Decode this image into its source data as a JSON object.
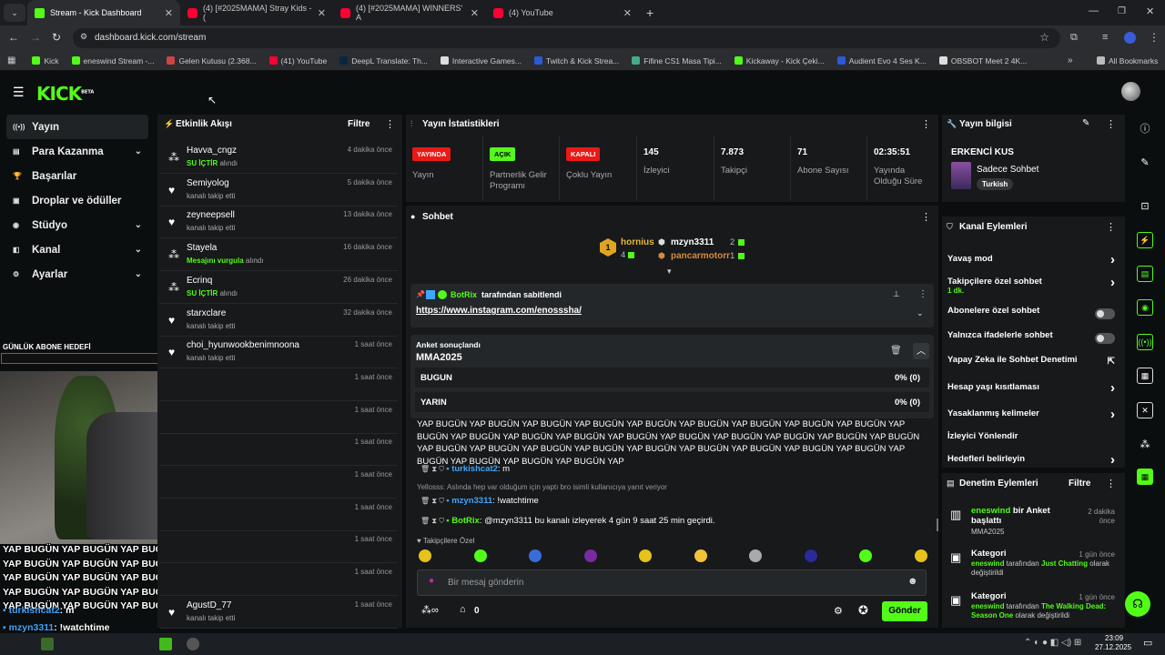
{
  "browser": {
    "tabs": [
      {
        "title": "Stream - Kick Dashboard",
        "favicon": "kick"
      },
      {
        "title": "(4) [#2025MAMA] Stray Kids - (",
        "favicon": "youtube"
      },
      {
        "title": "(4) [#2025MAMA] WINNERS' A",
        "favicon": "youtube"
      },
      {
        "title": "(4) YouTube",
        "favicon": "youtube"
      }
    ],
    "url": "dashboard.kick.com/stream",
    "bookmarks": [
      "Kick",
      "eneswind Stream -...",
      "Gelen Kutusu (2.368...",
      "(41) YouTube",
      "DeepL Translate: Th...",
      "Interactive Games...",
      "Twitch & Kick Strea...",
      "Fifine CS1 Masa Tipi...",
      "Kickaway - Kick Çeki...",
      "Audient Evo 4 Ses K...",
      "OBSBOT Meet 2 4K..."
    ],
    "all_bookmarks": "All Bookmarks"
  },
  "kick": {
    "logo": "KICK",
    "beta": "BETA"
  },
  "nav": {
    "items": [
      {
        "label": "Yayın",
        "icon": "broadcast-icon",
        "active": true,
        "chevron": false
      },
      {
        "label": "Para Kazanma",
        "icon": "money-icon",
        "chevron": true
      },
      {
        "label": "Başarılar",
        "icon": "trophy-icon",
        "chevron": false
      },
      {
        "label": "Droplar ve ödüller",
        "icon": "gift-icon",
        "chevron": false
      },
      {
        "label": "Stüdyo",
        "icon": "studio-icon",
        "chevron": true
      },
      {
        "label": "Kanal",
        "icon": "channel-icon",
        "chevron": true
      },
      {
        "label": "Ayarlar",
        "icon": "gear-icon",
        "chevron": true
      }
    ]
  },
  "activity": {
    "title": "Etkinlik Akışı",
    "filter": "Filtre",
    "events": [
      {
        "name": "Havva_cngz",
        "highlight": "SU İÇTİR",
        "desc": " alındı",
        "time": "4 dakika önce",
        "icon": "reward"
      },
      {
        "name": "Semiyolog",
        "highlight": "",
        "desc": "kanalı takip etti",
        "time": "5 dakika önce",
        "icon": "heart"
      },
      {
        "name": "zeyneepsell",
        "highlight": "",
        "desc": "kanalı takip etti",
        "time": "13 dakika önce",
        "icon": "heart"
      },
      {
        "name": "Stayela",
        "highlight": "Mesajını vurgula",
        "desc": " alındı",
        "time": "16 dakika önce",
        "icon": "reward"
      },
      {
        "name": "Ecrinq",
        "highlight": "SU İÇTİR",
        "desc": " alındı",
        "time": "26 dakika önce",
        "icon": "reward"
      },
      {
        "name": "starxclare",
        "highlight": "",
        "desc": "kanalı takip etti",
        "time": "32 dakika önce",
        "icon": "heart"
      },
      {
        "name": "choi_hyunwookbenimnoona",
        "highlight": "",
        "desc": "kanalı takip etti",
        "time": "1 saat önce",
        "icon": "heart"
      },
      {
        "name": "",
        "highlight": "",
        "desc": "",
        "time": "1 saat önce",
        "icon": ""
      },
      {
        "name": "",
        "highlight": "",
        "desc": "",
        "time": "1 saat önce",
        "icon": ""
      },
      {
        "name": "",
        "highlight": "",
        "desc": "",
        "time": "1 saat önce",
        "icon": ""
      },
      {
        "name": "",
        "highlight": "",
        "desc": "",
        "time": "1 saat önce",
        "icon": ""
      },
      {
        "name": "",
        "highlight": "",
        "desc": "",
        "time": "1 saat önce",
        "icon": ""
      },
      {
        "name": "",
        "highlight": "",
        "desc": "",
        "time": "1 saat önce",
        "icon": ""
      },
      {
        "name": "",
        "highlight": "",
        "desc": "",
        "time": "1 saat önce",
        "icon": ""
      },
      {
        "name": "AgustD_77",
        "highlight": "",
        "desc": "kanalı takip etti",
        "time": "1 saat önce",
        "icon": "heart"
      }
    ]
  },
  "overlay": {
    "goal_label": "GÜNLÜK ABONE HEDEFİ",
    "spam_lines": [
      "YAP BUGÜN YAP BUGÜN YAP BUGÜN YAP BUGÜN YAP BUGÜN",
      "YAP BUGÜN YAP BUGÜN YAP BUGÜN YAP BUGÜN YAP BUGÜN",
      "YAP BUGÜN YAP BUGÜN YAP BUGÜN YAP BUGÜN YAP BUGÜN",
      "YAP BUGÜN YAP BUGÜN YAP BUGÜN YAP BUGÜN YAP BUGÜN",
      "YAP BUGÜN YAP BUGÜN YAP BUGÜN YAP BUGÜN YAP BUGÜN YAP"
    ],
    "chat": [
      {
        "user": "turkishcat2",
        "msg": ": m",
        "color": "#3ea6ff"
      },
      {
        "user": "mzyn3311",
        "msg": ": !watchtime",
        "color": "#3ea6ff"
      },
      {
        "user": "BotRix",
        "msg": ": @mzyn3311 bu kanalı izleyerek 4 gün 9 saat 25 min geçirdi.",
        "color": "#53fc18"
      }
    ]
  },
  "stats": {
    "title": "Yayın İstatistikleri",
    "items": [
      {
        "badge": "YAYINDA",
        "badge_bg": "#e91916",
        "badge_fg": "#fff",
        "label": "Yayın"
      },
      {
        "badge": "AÇIK",
        "badge_bg": "#53fc18",
        "badge_fg": "#000",
        "label": "Partnerlik Gelir Programı"
      },
      {
        "badge": "KAPALI",
        "badge_bg": "#e91916",
        "badge_fg": "#fff",
        "label": "Çoklu Yayın"
      },
      {
        "value": "145",
        "label": "İzleyici"
      },
      {
        "value": "7.873",
        "label": "Takipçi"
      },
      {
        "value": "71",
        "label": "Abone Sayısı"
      },
      {
        "value": "02:35:51",
        "label": "Yayında Olduğu Süre"
      }
    ]
  },
  "chat": {
    "title": "Sohbet",
    "leaderboard": [
      {
        "rank": "1",
        "name": "hornius",
        "count": "4"
      },
      {
        "name": "mzyn3311",
        "count": "2"
      },
      {
        "name": "pancarmotorr",
        "count": "1"
      }
    ],
    "pinned": {
      "by": "BotRix",
      "suffix": " tarafından sabitlendi",
      "link": "https://www.instagram.com/enosssha/"
    },
    "poll": {
      "status": "Anket sonuçlandı",
      "title": "MMA2025",
      "options": [
        {
          "label": "BUGUN",
          "result": "0% (0)",
          "fraction": 0
        },
        {
          "label": "YARIN",
          "result": "0% (0)",
          "fraction": 0
        }
      ]
    },
    "spam": "YAP BUGÜN YAP BUGÜN YAP BUGÜN YAP BUGÜN YAP BUGÜN YAP BUGÜN YAP BUGÜN YAP BUGÜN YAP BUGÜN YAP BUGÜN YAP BUGÜN YAP BUGÜN YAP BUGÜN YAP BUGÜN YAP BUGÜN YAP BUGÜN YAP BUGÜN YAP BUGÜN YAP BUGÜN YAP BUGÜN YAP BUGÜN YAP BUGÜN YAP BUGÜN YAP BUGÜN YAP BUGÜN YAP BUGÜN YAP BUGÜN YAP BUGÜN YAP BUGÜN YAP BUGÜN YAP BUGÜN YAP BUGÜN YAP",
    "messages": [
      {
        "user": "turkishcat2",
        "text": ": m",
        "color": "#3ea6ff"
      },
      {
        "reply": "Yellosss: Aslında hep var olduğum için yaptı bro isimli kullanıcıya yanıt veriyor",
        "user": "mzyn3311",
        "text": ": !watchtime",
        "color": "#3ea6ff"
      },
      {
        "user": "BotRix",
        "text": ": @mzyn3311 bu kanalı izleyerek 4 gün 9 saat 25 min geçirdi.",
        "color": "#53fc18"
      }
    ],
    "emote_label": "Takipçilere Özel",
    "placeholder": "Bir mesaj gönderin",
    "points": "0",
    "send": "Gönder"
  },
  "info": {
    "title": "Yayın bilgisi",
    "stream_title": "ERKENCİ KUS",
    "category": "Sadece Sohbet",
    "tag": "Turkish"
  },
  "actions": {
    "title": "Kanal Eylemleri",
    "rows": [
      {
        "label": "Yavaş mod",
        "type": "arrow"
      },
      {
        "label": "Takipçilere özel sohbet",
        "sub": "1 dk.",
        "type": "arrow"
      },
      {
        "label": "Abonelere özel sohbet",
        "type": "toggle"
      },
      {
        "label": "Yalnızca ifadelerle sohbet",
        "type": "toggle"
      },
      {
        "label": "Yapay Zeka ile Sohbet Denetimi",
        "type": "link"
      },
      {
        "label": "Hesap yaşı kısıtlaması",
        "type": "arrow"
      },
      {
        "label": "Yasaklanmış kelimeler",
        "type": "arrow"
      },
      {
        "label": "İzleyici Yönlendir",
        "type": "none"
      },
      {
        "label": "Hedefleri belirleyin",
        "type": "arrow"
      }
    ]
  },
  "moderation": {
    "title": "Denetim Eylemleri",
    "filter": "Filtre",
    "items": [
      {
        "title_user": "eneswind",
        "title_rest": " bir Anket başlattı",
        "sub": "MMA2025",
        "time": "2 dakika önce"
      },
      {
        "title_user": "",
        "title_rest": "Kategori",
        "sub_user": "eneswind",
        "sub_mid": " tarafından ",
        "sub_hl": "Just Chatting",
        "sub_end": " olarak değiştirildi",
        "time": "1 gün önce"
      },
      {
        "title_user": "",
        "title_rest": "Kategori",
        "sub_user": "eneswind",
        "sub_mid": " tarafından ",
        "sub_hl": "The Walking Dead: Season One",
        "sub_end": " olarak değiştirildi",
        "time": "1 gün önce"
      }
    ]
  },
  "taskbar": {
    "time": "23:09",
    "date": "27.12.2025"
  }
}
